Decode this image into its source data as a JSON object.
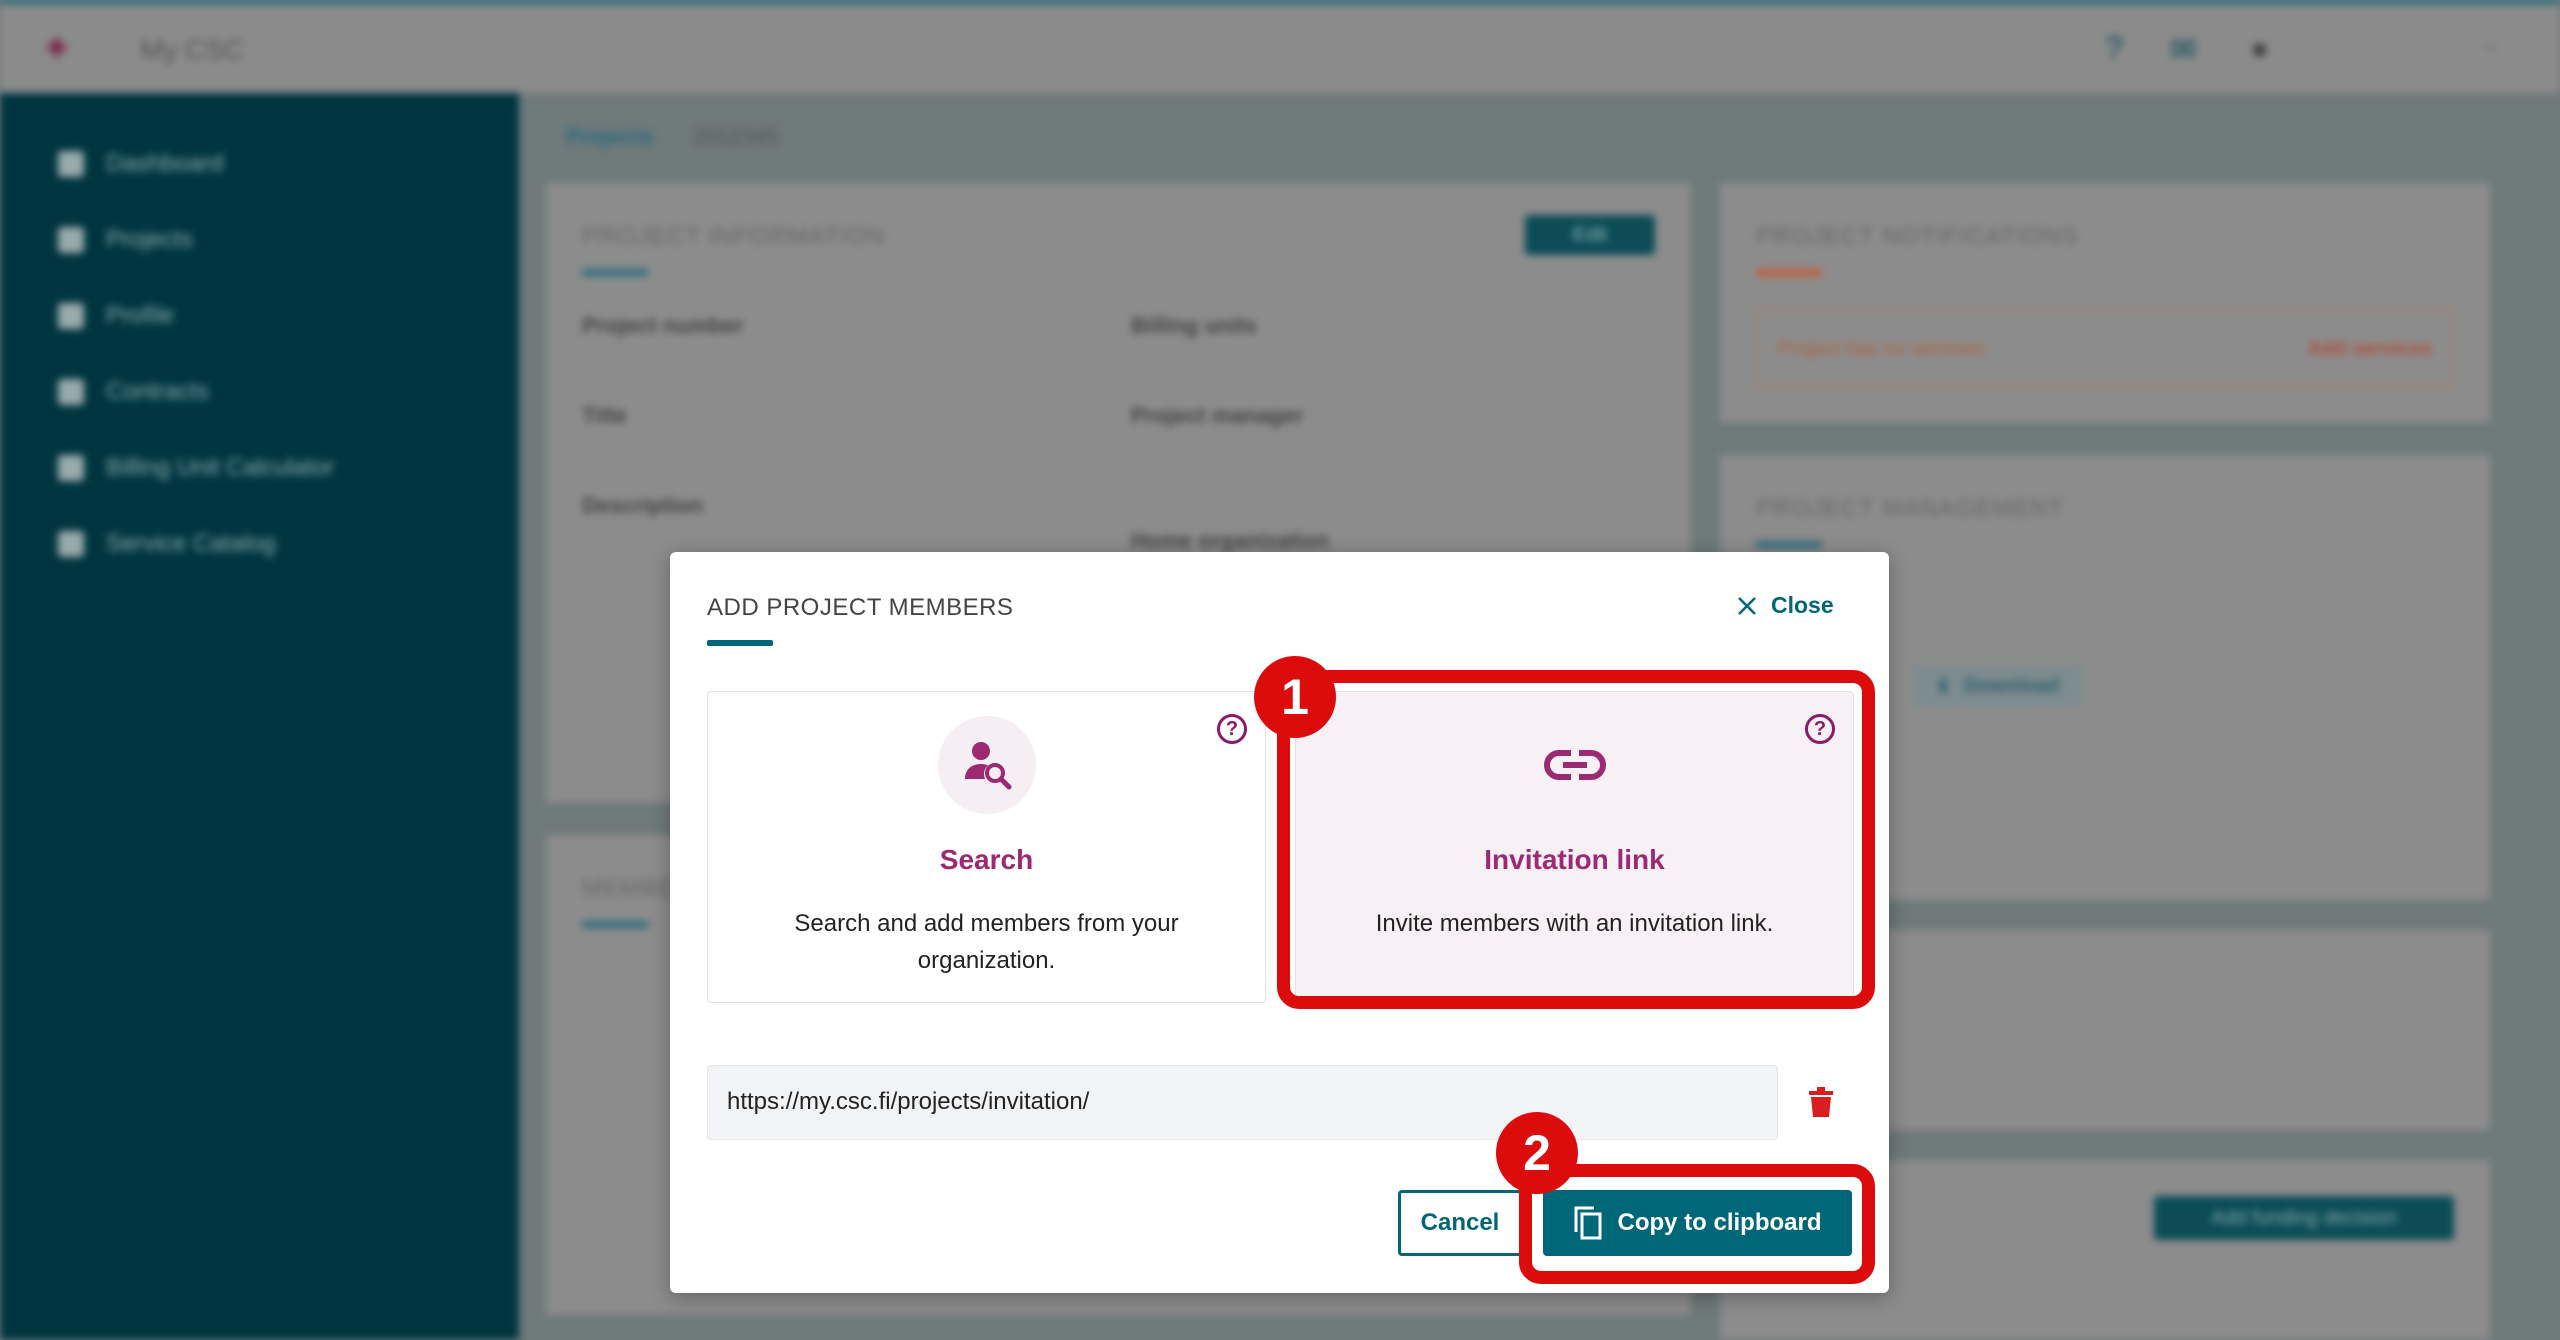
{
  "header": {
    "app_name": "My CSC"
  },
  "sidebar": {
    "items": [
      {
        "label": "Dashboard"
      },
      {
        "label": "Projects"
      },
      {
        "label": "Profile"
      },
      {
        "label": "Contracts"
      },
      {
        "label": "Billing Unit Calculator"
      },
      {
        "label": "Service Catalog"
      }
    ]
  },
  "breadcrumb": {
    "root": "Projects",
    "current": "2012345"
  },
  "background": {
    "project_info": {
      "title": "PROJECT INFORMATION",
      "edit": "Edit",
      "project_number_label": "Project number",
      "title_label": "Title",
      "description_label": "Description",
      "billing_units_label": "Billing units",
      "project_manager_label": "Project manager",
      "home_org_label": "Home organization"
    },
    "notifications": {
      "title": "PROJECT NOTIFICATIONS",
      "message": "Project has no services",
      "add_services": "Add services"
    },
    "management": {
      "title": "PROJECT MANAGEMENT",
      "download": "Download"
    },
    "members_title": "MEMBERS",
    "funding": {
      "add_funding": "Add funding decision"
    }
  },
  "modal": {
    "title": "ADD PROJECT MEMBERS",
    "close_label": "Close",
    "options": [
      {
        "title": "Search",
        "description": "Search and add members from your organization.",
        "icon": "user-search-icon"
      },
      {
        "title": "Invitation link",
        "description": "Invite members with an invitation link.",
        "icon": "link-icon"
      }
    ],
    "invitation_url": "https://my.csc.fi/projects/invitation/",
    "cancel_label": "Cancel",
    "copy_label": "Copy to clipboard"
  },
  "annotations": [
    {
      "number": "1"
    },
    {
      "number": "2"
    }
  ],
  "colors": {
    "primary": "#006778",
    "accent": "#9b2a72",
    "annotation": "#dc0c0c",
    "danger": "#d81e1e"
  }
}
